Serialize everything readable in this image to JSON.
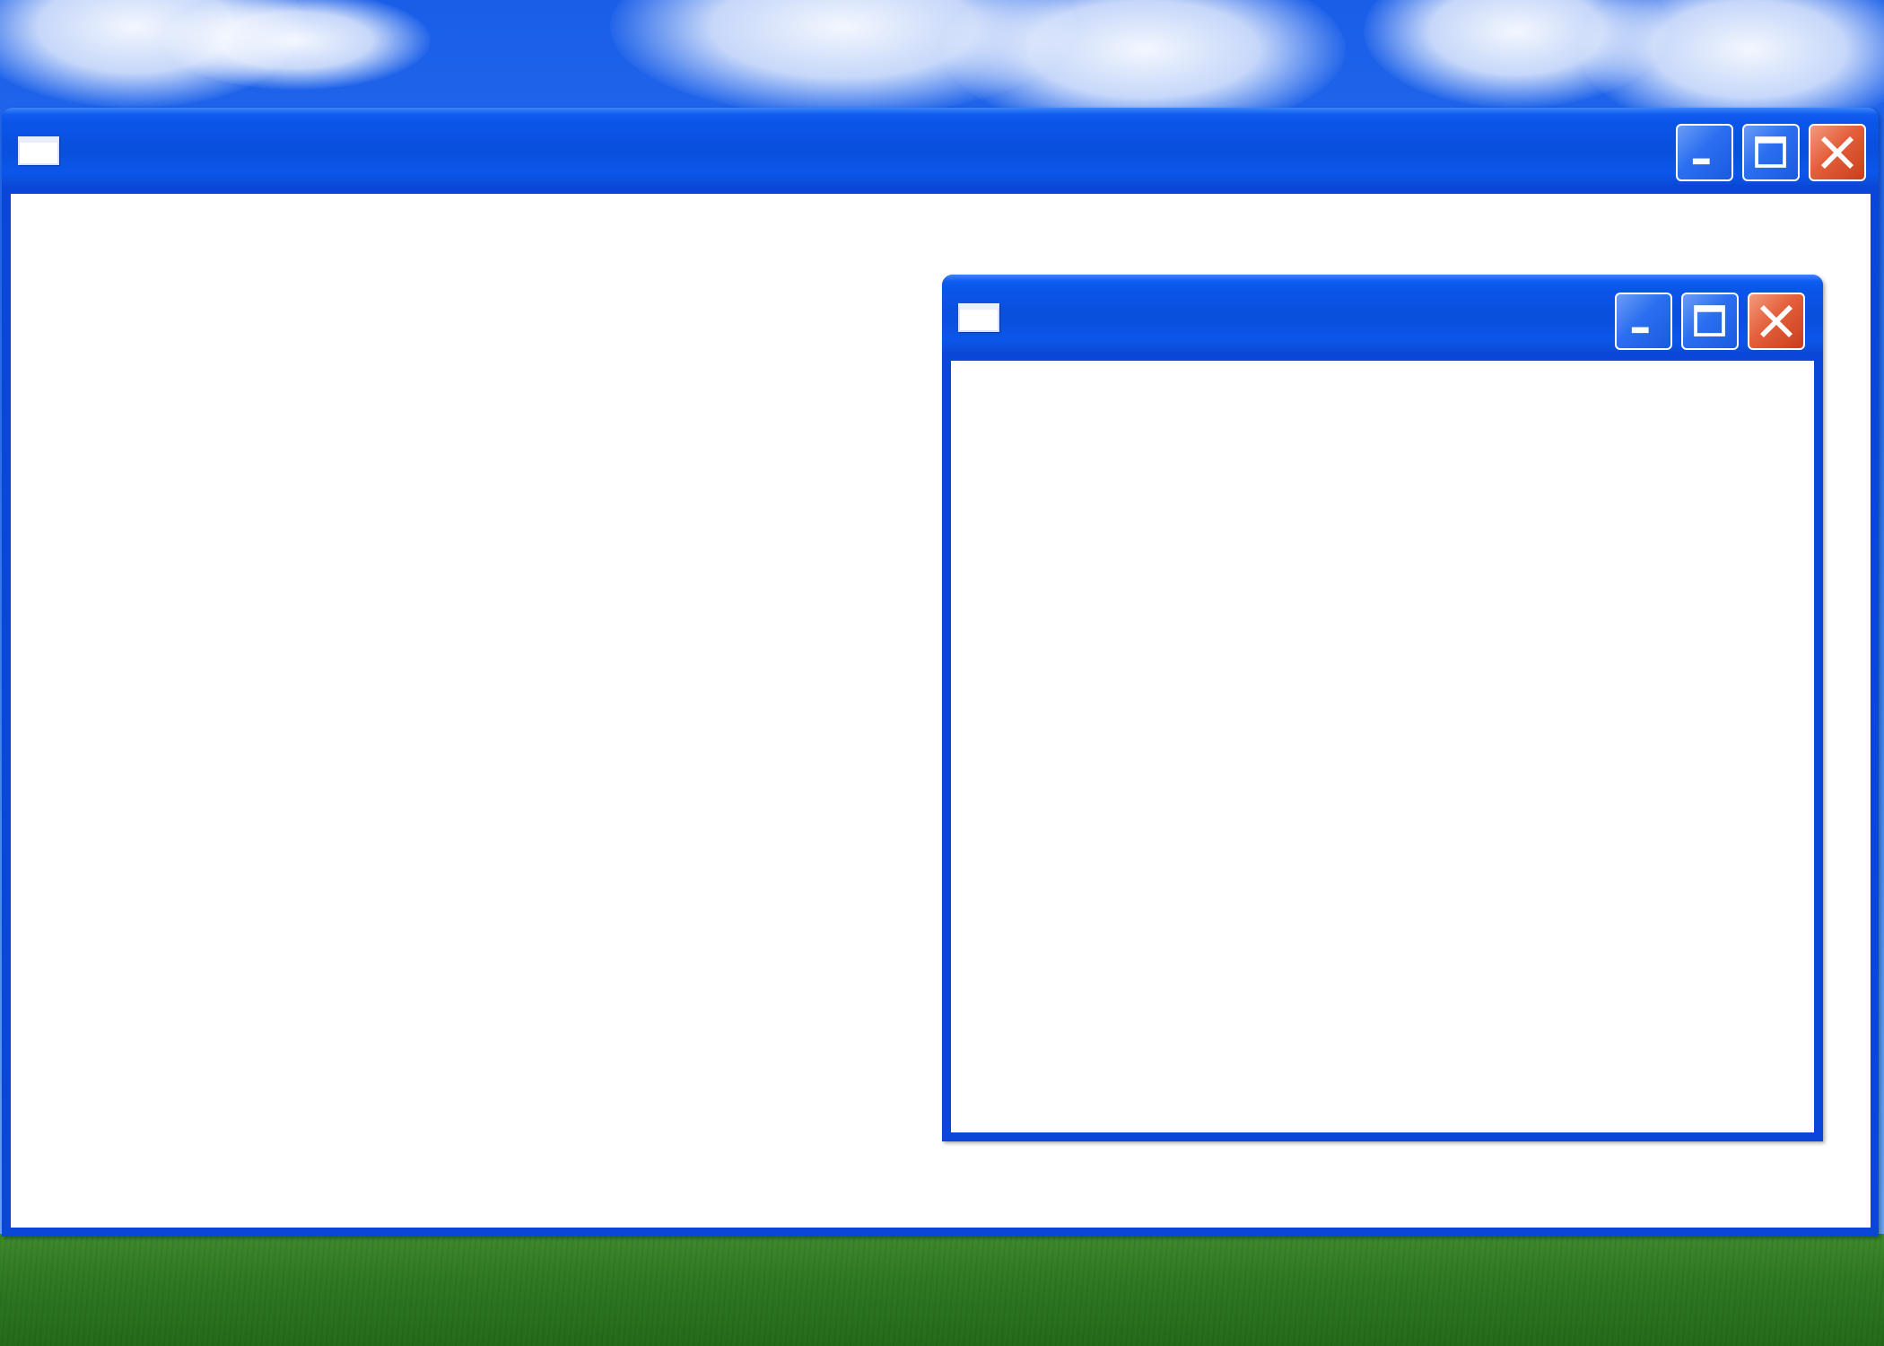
{
  "desktop": {
    "wallpaper": "bliss",
    "colors": {
      "sky": "#2c73ef",
      "grass": "#2f7a22"
    }
  },
  "windows": [
    {
      "title": "",
      "icon": "window-icon",
      "buttons": [
        "minimize-icon",
        "maximize-icon",
        "close-icon"
      ]
    },
    {
      "title": "",
      "icon": "window-icon",
      "buttons": [
        "minimize-icon",
        "maximize-icon",
        "close-icon"
      ]
    }
  ],
  "theme": {
    "titlebar": "#0a55e8",
    "frame": "#0a46d8",
    "client": "#ffffff",
    "close_button": "#e45f3a"
  }
}
